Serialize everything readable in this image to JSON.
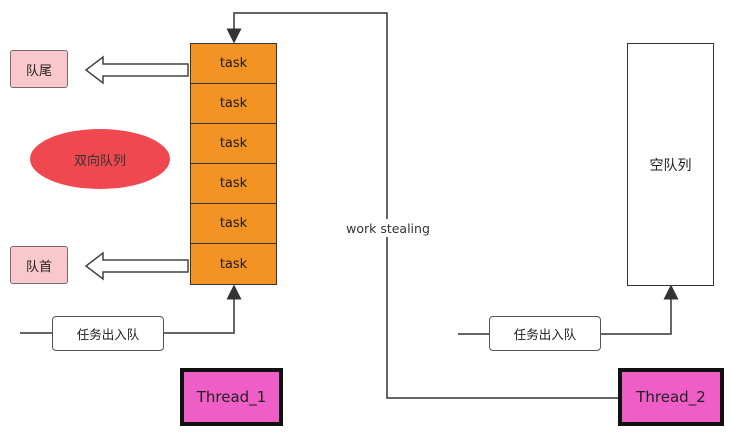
{
  "tail_label": "队尾",
  "head_label": "队首",
  "deque_label": "双向队列",
  "tasks": [
    "task",
    "task",
    "task",
    "task",
    "task",
    "task"
  ],
  "work_stealing_label": "work stealing",
  "enqueue_dequeue_left": "任务出入队",
  "enqueue_dequeue_right": "任务出入队",
  "empty_queue_label": "空队列",
  "thread1_label": "Thread_1",
  "thread2_label": "Thread_2"
}
